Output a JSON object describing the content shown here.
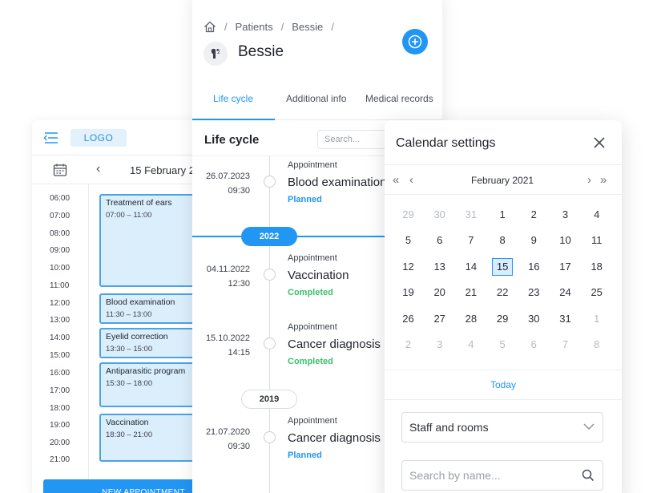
{
  "scheduler": {
    "logo": "LOGO",
    "date": "15 February 2",
    "hours": [
      "06:00",
      "07:00",
      "08:00",
      "09:00",
      "10:00",
      "11:00",
      "12:00",
      "13:00",
      "14:00",
      "15:00",
      "16:00",
      "17:00",
      "18:00",
      "19:00",
      "20:00",
      "21:00"
    ],
    "events": [
      {
        "title": "Treatment of ears",
        "time": "07:00 – 11:00"
      },
      {
        "title": "Blood examination",
        "time": "11:30 – 13:00"
      },
      {
        "title": "Eyelid correction",
        "time": "13:30 – 15:00"
      },
      {
        "title": "Antiparasitic program",
        "time": "15:30 – 18:00"
      },
      {
        "title": "Vaccination",
        "time": "18:30 – 21:00"
      }
    ],
    "new_appointment": "NEW APPOINTMENT"
  },
  "patient": {
    "breadcrumb": [
      "Patients",
      "Bessie"
    ],
    "name": "Bessie",
    "tabs": [
      "Life cycle",
      "Additional info",
      "Medical records"
    ],
    "section_title": "Life cycle",
    "search_placeholder": "Search...",
    "years": [
      "2022",
      "2019"
    ],
    "entries": [
      {
        "date": "26.07.2023",
        "time": "09:30",
        "type": "Appointment",
        "name": "Blood examination",
        "status": "Planned"
      },
      {
        "date": "04.11.2022",
        "time": "12:30",
        "type": "Appointment",
        "name": "Vaccination",
        "status": "Completed"
      },
      {
        "date": "15.10.2022",
        "time": "14:15",
        "type": "Appointment",
        "name": "Cancer diagnosis",
        "status": "Completed"
      },
      {
        "date": "21.07.2020",
        "time": "09:30",
        "type": "Appointment",
        "name": "Cancer diagnosis",
        "status": "Planned"
      }
    ]
  },
  "calendar": {
    "title": "Calendar settings",
    "month": "February 2021",
    "weeks": [
      [
        "29",
        "30",
        "31",
        "1",
        "2",
        "3",
        "4"
      ],
      [
        "5",
        "6",
        "7",
        "8",
        "9",
        "10",
        "11"
      ],
      [
        "12",
        "13",
        "14",
        "15",
        "16",
        "17",
        "18"
      ],
      [
        "19",
        "20",
        "21",
        "22",
        "23",
        "24",
        "25"
      ],
      [
        "26",
        "27",
        "28",
        "29",
        "30",
        "31",
        "1"
      ],
      [
        "2",
        "3",
        "4",
        "5",
        "6",
        "7",
        "8"
      ]
    ],
    "selected_day": "15",
    "today_label": "Today",
    "staff_select": "Staff and rooms",
    "search_placeholder": "Search by name..."
  },
  "colors": {
    "accent": "#2196f3",
    "planned": "#2196f3",
    "completed": "#3cc06a",
    "event_fill": "#dbeefb",
    "event_border": "#4aa3e6"
  }
}
